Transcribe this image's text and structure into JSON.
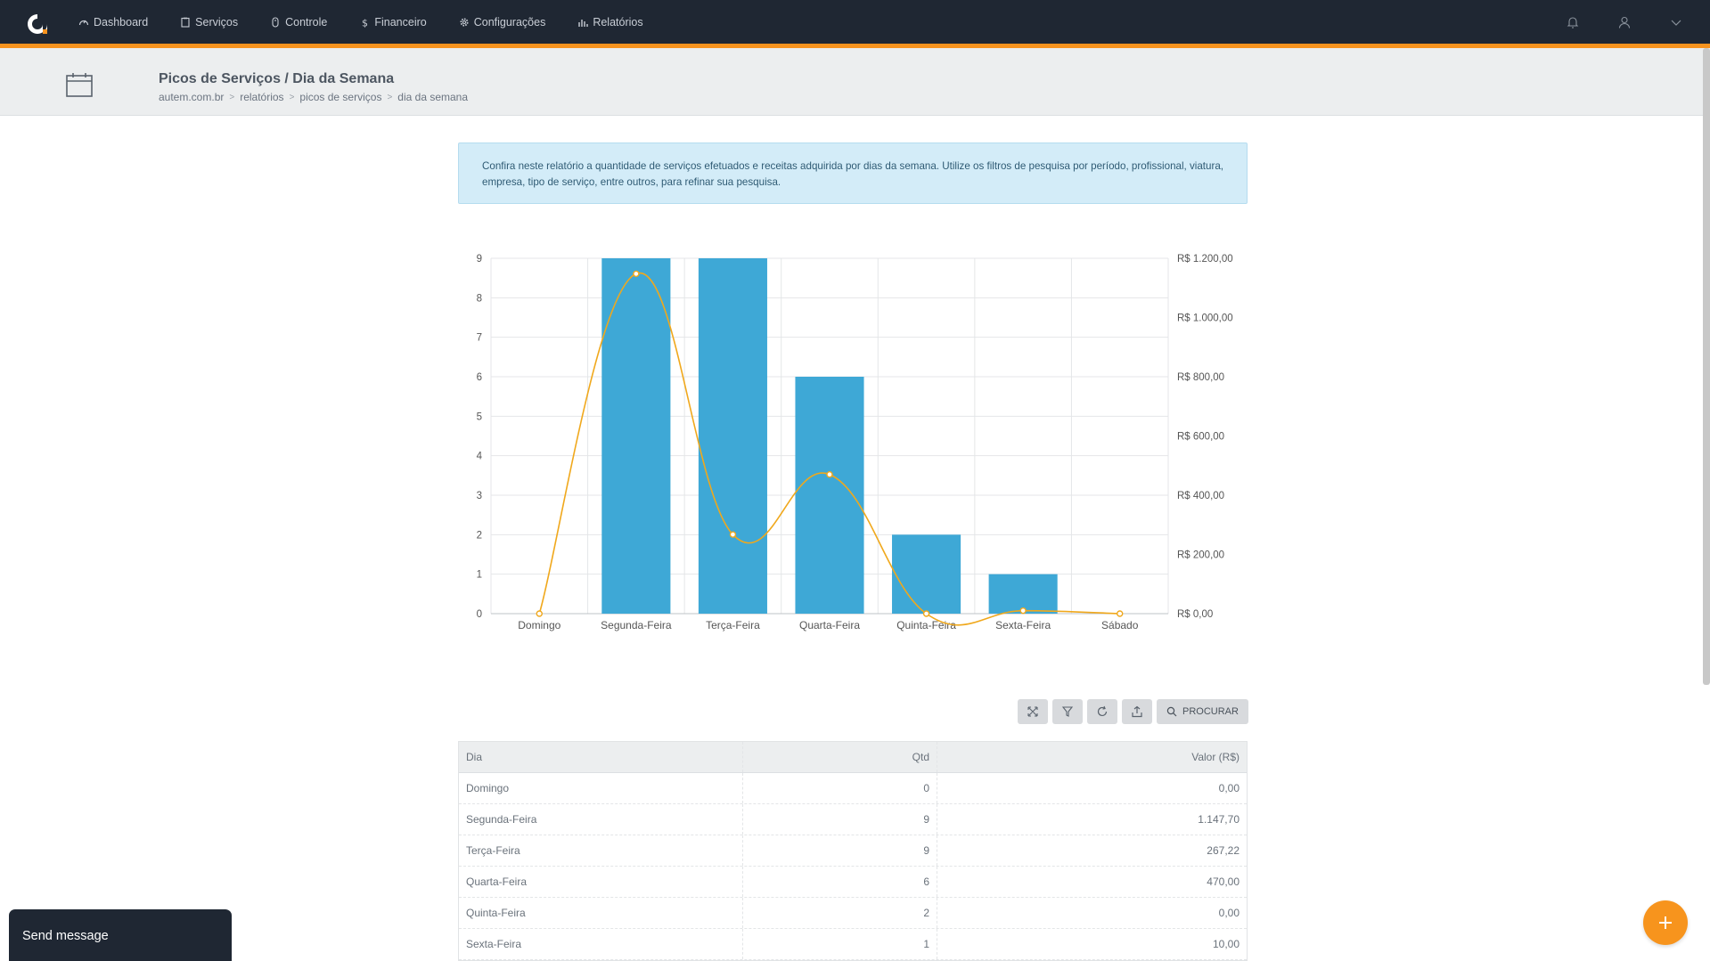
{
  "nav": {
    "items": [
      {
        "label": "Dashboard",
        "icon": "dashboard-icon"
      },
      {
        "label": "Serviços",
        "icon": "clipboard-icon"
      },
      {
        "label": "Controle",
        "icon": "mouse-icon"
      },
      {
        "label": "Financeiro",
        "icon": "dollar-icon"
      },
      {
        "label": "Configurações",
        "icon": "gear-icon"
      },
      {
        "label": "Relatórios",
        "icon": "bar-chart-icon"
      }
    ]
  },
  "header": {
    "title": "Picos de Serviços / Dia da Semana",
    "breadcrumb": [
      "autem.com.br",
      "relatórios",
      "picos de serviços",
      "dia da semana"
    ]
  },
  "info": {
    "text": "Confira neste relatório a quantidade de serviços efetuados e receitas adquirida por dias da semana. Utilize os filtros de pesquisa por período, profissional, viatura, empresa, tipo de serviço, entre outros, para refinar sua pesquisa."
  },
  "chart_data": {
    "type": "bar",
    "categories": [
      "Domingo",
      "Segunda-Feira",
      "Terça-Feira",
      "Quarta-Feira",
      "Quinta-Feira",
      "Sexta-Feira",
      "Sábado"
    ],
    "series": [
      {
        "type": "bar",
        "axis": "left",
        "values": [
          0,
          9,
          9,
          6,
          2,
          1,
          0
        ],
        "color": "#3ea8d6"
      },
      {
        "type": "line",
        "axis": "right",
        "values": [
          0,
          1147.7,
          267.22,
          470,
          0,
          10,
          0
        ],
        "color": "#f0a81c"
      }
    ],
    "ylim_left": [
      0,
      9
    ],
    "left_ticks": [
      "0",
      "1",
      "2",
      "3",
      "4",
      "5",
      "6",
      "7",
      "8",
      "9"
    ],
    "ylim_right": [
      0,
      1200
    ],
    "right_ticks": [
      "R$ 0,00",
      "R$ 200,00",
      "R$ 400,00",
      "R$ 600,00",
      "R$ 800,00",
      "R$ 1.000,00",
      "R$ 1.200,00"
    ],
    "grid": true
  },
  "toolbar": {
    "search_label": "PROCURAR"
  },
  "table": {
    "headers": [
      "Dia",
      "Qtd",
      "Valor (R$)"
    ],
    "rows": [
      [
        "Domingo",
        "0",
        "0,00"
      ],
      [
        "Segunda-Feira",
        "9",
        "1.147,70"
      ],
      [
        "Terça-Feira",
        "9",
        "267,22"
      ],
      [
        "Quarta-Feira",
        "6",
        "470,00"
      ],
      [
        "Quinta-Feira",
        "2",
        "0,00"
      ],
      [
        "Sexta-Feira",
        "1",
        "10,00"
      ]
    ]
  },
  "chat": {
    "label": "Send message"
  },
  "colors": {
    "topbar": "#1f2733",
    "accent": "#f7931e",
    "bar": "#3ea8d6",
    "line": "#f0a81c"
  }
}
